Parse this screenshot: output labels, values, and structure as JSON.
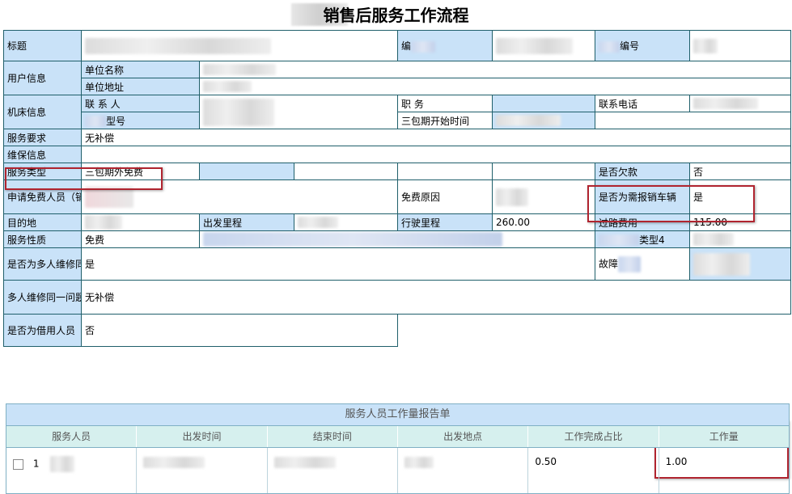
{
  "page_title": "销售后服务工作流程",
  "labels": {
    "title": "标题",
    "user_info": "用户信息",
    "unit_name": "单位名称",
    "unit_address": "单位地址",
    "machine_info": "机床信息",
    "contact": "联 系 人",
    "position": "职  务",
    "phone": "联系电话",
    "model": "型号",
    "warranty_start": "三包期开始时间",
    "service_req": "服务要求",
    "maintenance": "维保信息",
    "service_type": "服务类型",
    "arrears": "是否欠款",
    "free_applicant": "申请免费人员（销售）",
    "free_reason": "免费原因",
    "need_report_vehicle": "是否为需报销车辆",
    "destination": "目的地",
    "start_mileage": "出发里程",
    "drive_mileage": "行驶里程",
    "toll": "过路费用",
    "service_nature": "服务性质",
    "type4": "类型4",
    "multi_repair": "是否为多人维修同一问题",
    "fault": "故障",
    "multi_desc": "多人维修同一问题的描述",
    "borrowed": "是否为借用人员",
    "num": "编号",
    "num_prefix": "编"
  },
  "values": {
    "service_req": "无补偿",
    "service_type": "三包期外免费",
    "arrears": "否",
    "need_report_vehicle": "是",
    "drive_mileage": "260.00",
    "toll": "115.00",
    "service_nature": "免费",
    "multi_repair": "是",
    "multi_desc": "无补偿",
    "borrowed": "否"
  },
  "workload": {
    "title": "服务人员工作量报告单",
    "columns": [
      "服务人员",
      "出发时间",
      "结束时间",
      "出发地点",
      "工作完成占比",
      "工作量"
    ],
    "rows": [
      {
        "index": "1",
        "ratio": "0.50",
        "amount": "1.00"
      }
    ]
  }
}
